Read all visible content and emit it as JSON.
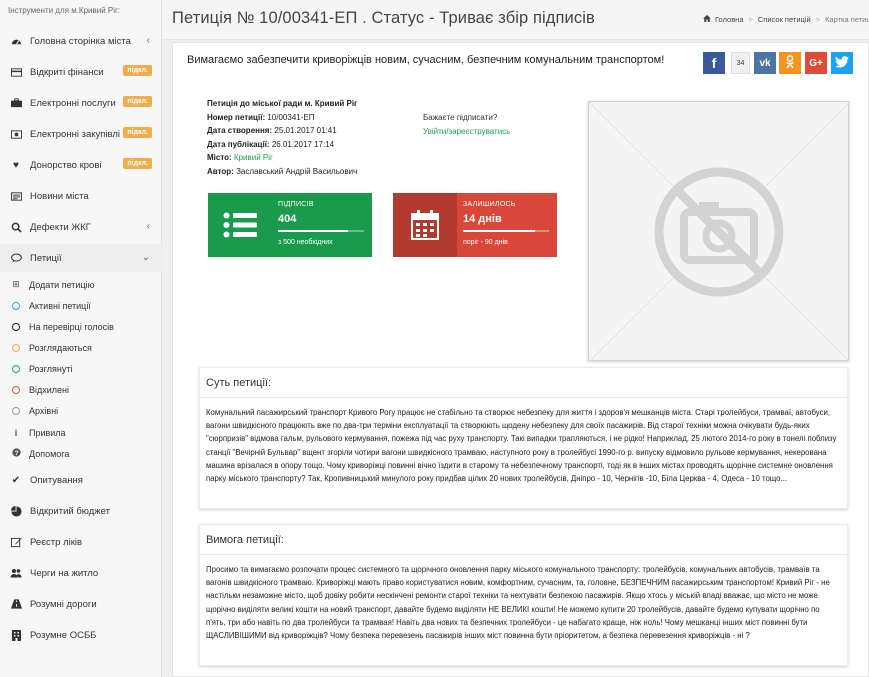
{
  "sidebar": {
    "caption": "Інструменти для м.Кривий Ріг:",
    "badge": "підкл.",
    "items": [
      {
        "label": "Головна сторінка міста",
        "icon": "dashboard-icon"
      },
      {
        "label": "Відкриті фінанси",
        "icon": "credit-card-icon"
      },
      {
        "label": "Електронні послуги",
        "icon": "briefcase-icon"
      },
      {
        "label": "Електронні закупівлі",
        "icon": "money-icon"
      },
      {
        "label": "Донорство крові",
        "icon": "heartbeat-icon"
      },
      {
        "label": "Новини міста",
        "icon": "newspaper-icon"
      },
      {
        "label": "Дефекти ЖКГ",
        "icon": "search-icon"
      },
      {
        "label": "Петиції",
        "icon": "comment-icon"
      },
      {
        "label": "Опитування",
        "icon": "check-icon"
      },
      {
        "label": "Відкритий бюджет",
        "icon": "pie-chart-icon"
      },
      {
        "label": "Реєстр ліків",
        "icon": "edit-icon"
      },
      {
        "label": "Черги на житло",
        "icon": "users-icon"
      },
      {
        "label": "Розумні дороги",
        "icon": "road-icon"
      },
      {
        "label": "Розумне ОСББ",
        "icon": "building-icon"
      }
    ],
    "petition_sub": [
      {
        "label": "Додати петицію",
        "icon": "plus-square-icon",
        "color": "#888888"
      },
      {
        "label": "Активні петиції",
        "icon": "circle-icon",
        "color": "#3aa0d8"
      },
      {
        "label": "На перевірці голосів",
        "icon": "circle-icon",
        "color": "#222222"
      },
      {
        "label": "Розглядаються",
        "icon": "circle-icon",
        "color": "#f0ad4e"
      },
      {
        "label": "Розглянуті",
        "icon": "circle-icon",
        "color": "#2ea84f"
      },
      {
        "label": "Відхилені",
        "icon": "circle-icon",
        "color": "#d9534f"
      },
      {
        "label": "Архівні",
        "icon": "circle-icon",
        "color": "#999999"
      },
      {
        "label": "Привила",
        "icon": "info-icon",
        "color": "#555555"
      },
      {
        "label": "Допомога",
        "icon": "question-icon",
        "color": "#555555"
      }
    ]
  },
  "header": {
    "title": "Петиція № 10/00341-ЕП . Статус - Триває збір підписів",
    "breadcrumb": [
      "Головна",
      "Список петицій",
      "Картка петиції"
    ]
  },
  "petition": {
    "headline": "Вимагаємо забезпечити криворіжців новим, сучасним, безпечним комунальним транспортом!",
    "share_count": "34",
    "to_label": "Петиція до міської ради м. Кривий Ріг",
    "number_label": "Номер петиції:",
    "number_value": "10/00341-ЕП",
    "created_label": "Дата створення:",
    "created_value": "25.01.2017 01:41",
    "published_label": "Дата публікації:",
    "published_value": "26.01.2017 17:14",
    "city_label": "Місто:",
    "city_value": "Кривий Ріг",
    "author_label": "Автор:",
    "author_value": "Заславський Андрій Васильович",
    "sign_question": "Бажаєте підписати?",
    "sign_link": "Увійти/зареєструватись",
    "signatures": {
      "label": "ПІДПИСІВ",
      "value": "404",
      "sub": "з 500 необхідних",
      "progress": 0.81
    },
    "remaining": {
      "label": "ЗАЛИШИЛОСЬ",
      "value": "14 днів",
      "sub": "поріг - 90 днів",
      "progress": 0.84
    },
    "colors": {
      "green": "#1a9b4b",
      "red": "#d9473a",
      "link": "#1f9d55"
    },
    "essence_title": "Суть петиції:",
    "essence_text": "Комунальний пасажирський транспорт Кривого Рогу працює не стабільно та створює небезпеку для життя і здоров'я мешканців міста. Старі тролейбуси, трамваї, автобуси, вагони швидкісного працюють вже по два-три терміни експлуатації та створюють щодену небезпеку для своїх пасажирів. Від старої техніки можна очікувати будь-яких \"сюрпризів\" відмова гальм, рульового кермування, пожежа під час руху транспорту. Такі випадки трапляються, і не рідко! Наприклад, 25 лютого 2014-го року в тонелі поблизу станції \"Вечірній Бульвар\" вщент згоріли чотири вагони швидкісного трамваю, наступного року в тролейбусі 1990-го р. випуску відмовило рульове кермування, некерована машина врізалася в опору тощо. Чому криворіжці повинні вічно їздити в старому та небезпечному транспорті, тоді як в інших містах проводять щорічне системне оновлення парку міського транспорту? Так, Кропивницький минулого року придбав цілих 20 нових тролейбусів, Дніпро - 10, Чернігів -10, Біла Церква - 4, Одеса - 10 тощо...",
    "demand_title": "Вимога петиції:",
    "demand_text": "Просимо та вимагаємо розпочати процес системного та щорічного оновлення парку міського комунального транспорту: тролейбусів, комунальних автобусів, трамваїв та вагонів швидкісного трамваю. Криворіжці мають право користуватися новим, комфортним, сучасним, та, головне, БЕЗПЕЧНИМ пасажирським транспортом! Кривий Ріг - не настільки незаможне місто, щоб довіку робити нескінчені ремонти старої техніки та нехтувати безпекою пасажирів. Якщо хтось у міській владі вважає, що місто не може щорічно виділяти великі кошти на новий транспорт, давайте будемо виділяти НЕ ВЕЛИКІ кошти! Не можемо купити 20 тролейбусів, давайте будемо купувати щорічно по п'ять, три або навіть по два тролейбуси та трамвая! Навіть два нових та безпечних тролейбуси - це набагато краще, ніж ноль! Чому мешканці інших міст повинні бути ЩАСЛИВІШИМИ від криворіжців? Чому безпека перевезень пасажирів інших міст повинна бути пріоритетом, а безпека перевезення криворіжців - ні ?"
  }
}
